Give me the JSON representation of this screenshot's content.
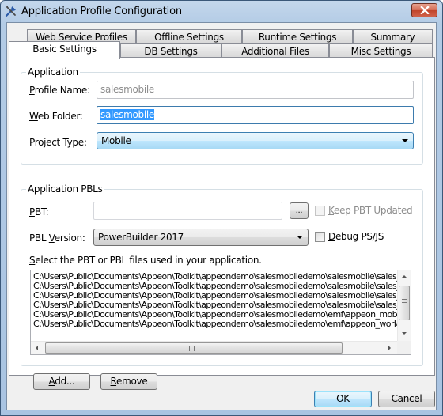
{
  "window": {
    "title": "Application Profile Configuration",
    "icon": "tools-icon",
    "close_label": "close"
  },
  "tabs": {
    "row_back": [
      {
        "label": "Web Service Profiles"
      },
      {
        "label": "Offline Settings"
      },
      {
        "label": "Runtime Settings"
      },
      {
        "label": "Summary"
      }
    ],
    "row_front": [
      {
        "label": "Basic Settings",
        "active": true
      },
      {
        "label": "DB Settings"
      },
      {
        "label": "Additional Files"
      },
      {
        "label": "Misc Settings"
      }
    ]
  },
  "application": {
    "group_title": "Application",
    "profile_name": {
      "label_prefix": "",
      "label_mnemonic": "P",
      "label_rest": "rofile Name:",
      "value": "salesmobile",
      "disabled": true
    },
    "web_folder": {
      "label_mnemonic": "W",
      "label_rest": "eb Folder:",
      "value": "salesmobile",
      "selected": true
    },
    "project_type": {
      "label": "Project Type:",
      "value": "Mobile"
    }
  },
  "pbls": {
    "group_title": "Application PBLs",
    "pbt": {
      "label_mnemonic": "P",
      "label_rest": "BT:",
      "value": "",
      "browse_label": "...",
      "browse_mnemonic": "_"
    },
    "keep_pbt_updated": {
      "label_mnemonic": "K",
      "label_rest": "eep PBT Updated",
      "checked": false,
      "disabled": true
    },
    "pbl_version": {
      "label_prefix": "PBL ",
      "label_mnemonic": "V",
      "label_rest": "ersion:",
      "value": "PowerBuilder 2017"
    },
    "debug_psjs": {
      "label_mnemonic": "D",
      "label_rest": "ebug PS/JS",
      "checked": false
    },
    "instruction": {
      "label_mnemonic": "S",
      "label_rest": "elect the PBT or PBL files used in your application."
    },
    "files": [
      "C:\\Users\\Public\\Documents\\Appeon\\Toolkit\\appeondemo\\salesmobiledemo\\salesmobile\\sales_",
      "C:\\Users\\Public\\Documents\\Appeon\\Toolkit\\appeondemo\\salesmobiledemo\\salesmobile\\sales_",
      "C:\\Users\\Public\\Documents\\Appeon\\Toolkit\\appeondemo\\salesmobiledemo\\salesmobile\\sales_",
      "C:\\Users\\Public\\Documents\\Appeon\\Toolkit\\appeondemo\\salesmobiledemo\\salesmobile\\sales_",
      "C:\\Users\\Public\\Documents\\Appeon\\Toolkit\\appeondemo\\salesmobiledemo\\emf\\appeon_mobil",
      "C:\\Users\\Public\\Documents\\Appeon\\Toolkit\\appeondemo\\salesmobiledemo\\emf\\appeon_work."
    ]
  },
  "buttons": {
    "add": {
      "mnemonic": "A",
      "rest": "dd..."
    },
    "remove": {
      "mnemonic": "R",
      "rest": "emove"
    },
    "ok": "OK",
    "cancel": "Cancel"
  }
}
